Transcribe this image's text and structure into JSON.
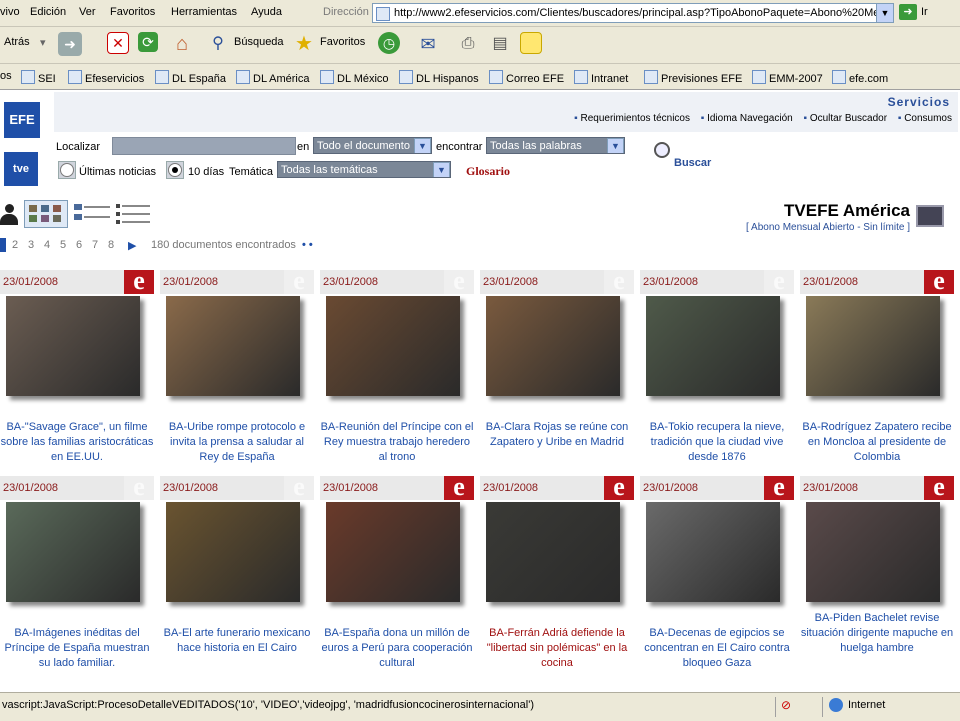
{
  "menu": {
    "items": [
      "vivo",
      "Edición",
      "Ver",
      "Favoritos",
      "Herramientas",
      "Ayuda"
    ],
    "address_label": "Dirección",
    "go_label": "Ir"
  },
  "address": {
    "url": "http://www2.efeservicios.com/Clientes/buscadores/principal.asp?TipoAbonoPaquete=Abono%20Me"
  },
  "toolbar": {
    "back_label": "Atrás",
    "search_label": "Búsqueda",
    "favorites_label": "Favoritos"
  },
  "links": {
    "prefix": "os",
    "items": [
      "SEI",
      "Efeservicios",
      "DL España",
      "DL América",
      "DL México",
      "DL Hispanos",
      "Correo EFE",
      "Intranet",
      "Previsiones EFE",
      "EMM-2007",
      "efe.com"
    ]
  },
  "header": {
    "servicios": "Servicios",
    "links": [
      "Requerimientos técnicos",
      "Idioma Navegación",
      "Ocultar Buscador",
      "Consumos"
    ],
    "logo_fe": "EFE",
    "logo_tve": "tve"
  },
  "search": {
    "localizar_label": "Localizar",
    "en_label": "en",
    "scope_value": "Todo el documento",
    "encontrar_label": "encontrar",
    "words_value": "Todas las palabras",
    "radio_last": "Últimas noticias",
    "radio_10": "10 días",
    "tematica_label": "Temática",
    "tematica_value": "Todas las temáticas",
    "glosario": "Glosario",
    "buscar": "Buscar"
  },
  "view": {
    "title": "TVEFE América",
    "subtitle": "[ Abono Mensual Abierto - Sin límite ]"
  },
  "pager": {
    "pages": [
      "2",
      "3",
      "4",
      "5",
      "6",
      "7",
      "8"
    ],
    "count_text": "180 documentos encontrados"
  },
  "cards": [
    {
      "date": "23/01/2008",
      "title": "BA-\"Savage Grace\", un filme sobre las familias aristocráticas en EE.UU.",
      "logo_active": true,
      "color": "#6b5d52"
    },
    {
      "date": "23/01/2008",
      "title": "BA-Uribe rompe protocolo e invita la prensa a saludar al Rey de España",
      "logo_active": false,
      "color": "#8a6a4a"
    },
    {
      "date": "23/01/2008",
      "title": "BA-Reunión del Príncipe con el Rey muestra trabajo heredero al trono",
      "logo_active": false,
      "color": "#6a4a32"
    },
    {
      "date": "23/01/2008",
      "title": "BA-Clara Rojas se reúne con Zapatero y Uribe en Madrid",
      "logo_active": false,
      "color": "#7a5a3e"
    },
    {
      "date": "23/01/2008",
      "title": "BA-Tokio recupera la nieve, tradición que la ciudad vive desde 1876",
      "logo_active": false,
      "color": "#4f5a4a"
    },
    {
      "date": "23/01/2008",
      "title": "BA-Rodríguez Zapatero recibe en Moncloa al presidente de Colombia",
      "logo_active": true,
      "color": "#8a7a58"
    },
    {
      "date": "23/01/2008",
      "title": "BA-Imágenes inéditas del Príncipe de España muestran su lado familiar.",
      "logo_active": false,
      "color": "#5a6a5a"
    },
    {
      "date": "23/01/2008",
      "title": "BA-El arte funerario mexicano hace historia en El Cairo",
      "logo_active": false,
      "color": "#6a5430"
    },
    {
      "date": "23/01/2008",
      "title": "BA-España dona un millón de euros a Perú para cooperación cultural",
      "logo_active": true,
      "color": "#6a3a2a"
    },
    {
      "date": "23/01/2008",
      "title": "BA-Ferrán Adriá defiende la \"libertad sin polémicas\" en la cocina",
      "logo_active": true,
      "color": "#3a3a36",
      "red": true
    },
    {
      "date": "23/01/2008",
      "title": "BA-Decenas de egipcios se concentran en El Cairo contra bloqueo Gaza",
      "logo_active": true,
      "color": "#6a6a6a"
    },
    {
      "date": "23/01/2008",
      "title": "BA-Piden Bachelet revise situación dirigente mapuche en huelga hambre",
      "logo_active": true,
      "color": "#5a4a4a"
    }
  ],
  "status": {
    "text": "vascript:JavaScript:ProcesoDetalleVEDITADOS('10', 'VIDEO','videojpg', 'madridfusioncocinerosinternacional')",
    "zone": "Internet"
  },
  "colors": {
    "chrome": "#ece9d8",
    "accent": "#1f4fa8",
    "efe_red": "#b8151b"
  }
}
